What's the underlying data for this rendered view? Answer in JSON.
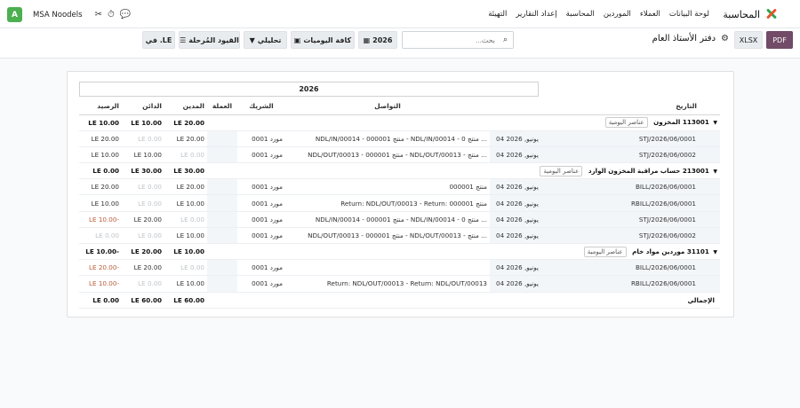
{
  "nav": {
    "app_name": "المحاسبة",
    "menu": [
      "لوحة البيانات",
      "العملاء",
      "الموردين",
      "المحاسبة",
      "إعداد التقارير",
      "التهيئة"
    ],
    "company": "MSA Noodels",
    "avatar": "A"
  },
  "control": {
    "pdf_label": "PDF",
    "xlsx_label": "XLSX",
    "title": "دفتر الأستاذ العام",
    "search_placeholder": "بحث...",
    "year_label": "2026",
    "journals_label": "كافة اليوميات",
    "analytic_label": "تحليلي",
    "posted_label": "القيود المُرحلة",
    "currency_label": "في .LE"
  },
  "report": {
    "year_header": "2026",
    "columns": {
      "date": "التاريخ",
      "communication": "التواصل",
      "partner": "الشريك",
      "currency": "العملة",
      "debit": "المدين",
      "credit": "الدائن",
      "balance": "الرصيد"
    },
    "journal_items_tag": "عناصر اليومية",
    "groups": [
      {
        "account": "113001 المخزون",
        "debit": "LE 20.00",
        "credit": "LE 10.00",
        "balance": "LE 10.00",
        "lines": [
          {
            "ref": "STJ/2026/06/0001",
            "date": "04 يونيو, 2026",
            "comm": "NDL/IN/00014 - منتج 000001 - NDL/IN/00014 - منتج 0 ...",
            "partner": "مورد 0001",
            "debit": "LE 20.00",
            "credit": "LE 0.00",
            "balance": "LE 20.00"
          },
          {
            "ref": "STJ/2026/06/0002",
            "date": "04 يونيو, 2026",
            "comm": "NDL/OUT/00013 - منتج 000001 - NDL/OUT/00013 - منتج ...",
            "partner": "مورد 0001",
            "debit": "LE 0.00",
            "credit": "LE 10.00",
            "balance": "LE 10.00"
          }
        ]
      },
      {
        "account": "213001 حساب مراقبة المخزون الوارد",
        "debit": "LE 30.00",
        "credit": "LE 30.00",
        "balance": "LE 0.00",
        "lines": [
          {
            "ref": "BILL/2026/06/0001",
            "date": "04 يونيو, 2026",
            "comm": "منتج 000001",
            "partner": "مورد 0001",
            "debit": "LE 20.00",
            "credit": "LE 0.00",
            "balance": "LE 20.00"
          },
          {
            "ref": "RBILL/2026/06/0001",
            "date": "04 يونيو, 2026",
            "comm": "Return: NDL/OUT/00013 - Return: منتج 000001",
            "partner": "مورد 0001",
            "debit": "LE 10.00",
            "credit": "LE 0.00",
            "balance": "LE 10.00"
          },
          {
            "ref": "STJ/2026/06/0001",
            "date": "04 يونيو, 2026",
            "comm": "NDL/IN/00014 - منتج 000001 - NDL/IN/00014 - منتج 0 ...",
            "partner": "مورد 0001",
            "debit": "LE 0.00",
            "credit": "LE 20.00",
            "balance": "LE 10.00-"
          },
          {
            "ref": "STJ/2026/06/0002",
            "date": "04 يونيو, 2026",
            "comm": "NDL/OUT/00013 - منتج 000001 - NDL/OUT/00013 - منتج ...",
            "partner": "مورد 0001",
            "debit": "LE 10.00",
            "credit": "LE 0.00",
            "balance": "LE 0.00"
          }
        ]
      },
      {
        "account": "31101 موردين مواد خام",
        "debit": "LE 10.00",
        "credit": "LE 20.00",
        "balance": "LE 10.00-",
        "lines": [
          {
            "ref": "BILL/2026/06/0001",
            "date": "04 يونيو, 2026",
            "comm": "",
            "partner": "مورد 0001",
            "debit": "LE 0.00",
            "credit": "LE 20.00",
            "balance": "LE 20.00-"
          },
          {
            "ref": "RBILL/2026/06/0001",
            "date": "04 يونيو, 2026",
            "comm": "Return: NDL/OUT/00013 - Return: NDL/OUT/00013",
            "partner": "مورد 0001",
            "debit": "LE 10.00",
            "credit": "LE 0.00",
            "balance": "LE 10.00-"
          }
        ]
      }
    ],
    "total": {
      "label": "الإجمالي",
      "debit": "LE 60.00",
      "credit": "LE 60.00",
      "balance": "LE 0.00"
    }
  }
}
